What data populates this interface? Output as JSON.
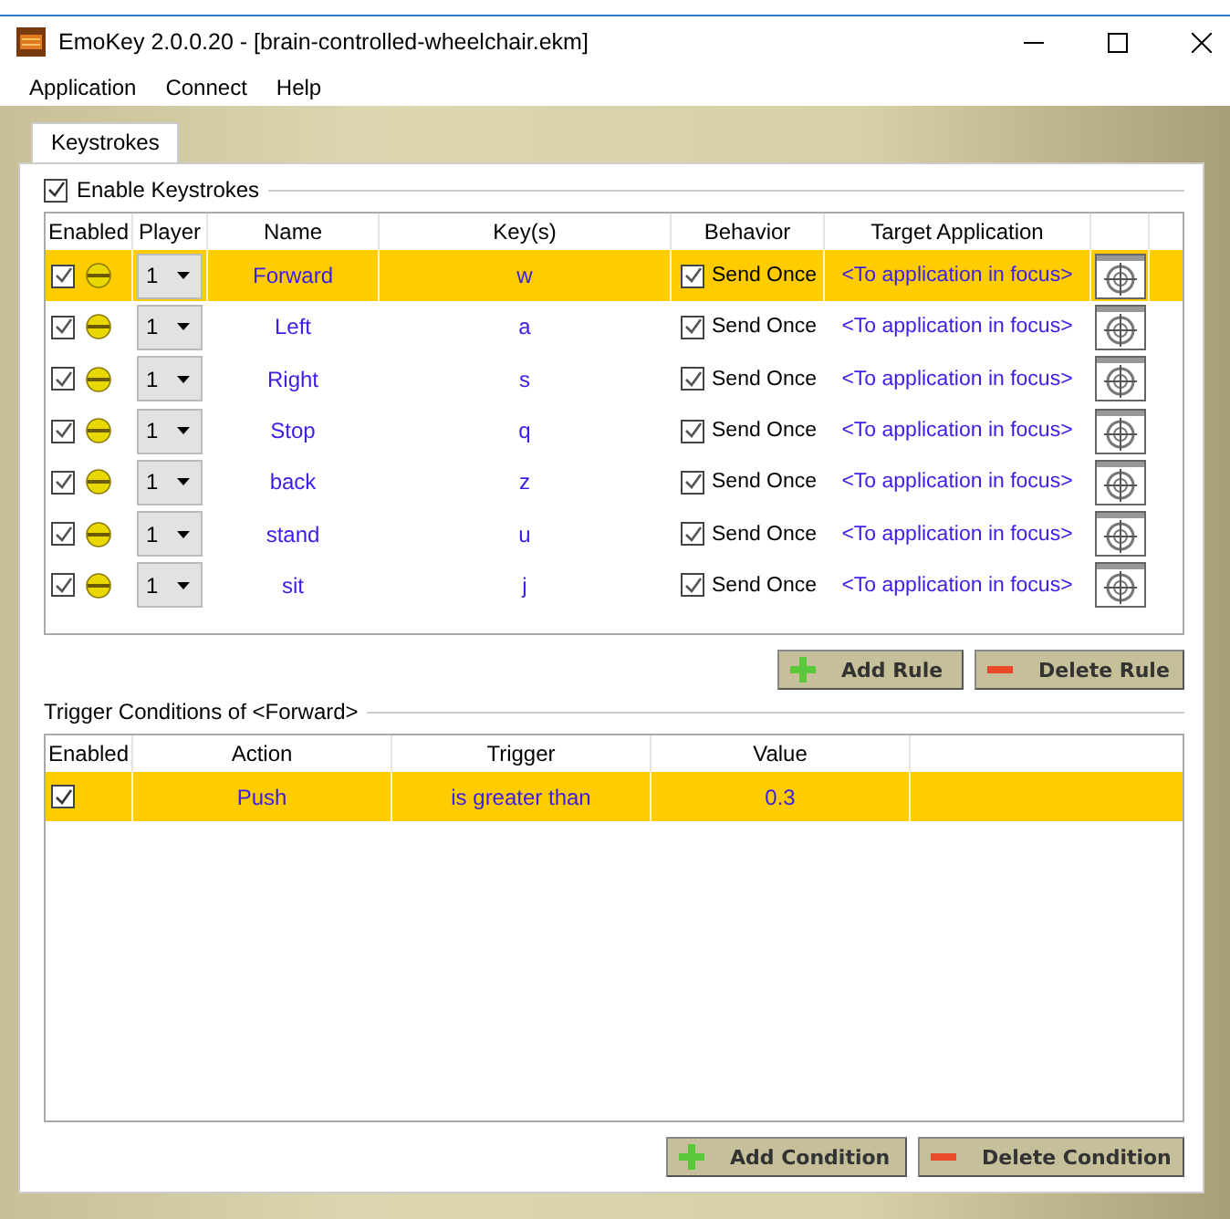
{
  "window": {
    "title": "EmoKey 2.0.0.20 - [brain-controlled-wheelchair.ekm]"
  },
  "menu": [
    "Application",
    "Connect",
    "Help"
  ],
  "tabs": [
    {
      "label": "Keystrokes",
      "selected": true
    }
  ],
  "enable_keystrokes": {
    "label": "Enable Keystrokes",
    "checked": true
  },
  "rules": {
    "columns": [
      "Enabled",
      "Player",
      "Name",
      "Key(s)",
      "Behavior",
      "Target Application"
    ],
    "rows": [
      {
        "enabled": true,
        "player": "1",
        "name": "Forward",
        "keys": "w",
        "behavior": {
          "checked": true,
          "label": "Send Once"
        },
        "target": "<To application in focus>",
        "selected": true
      },
      {
        "enabled": true,
        "player": "1",
        "name": "Left",
        "keys": "a",
        "behavior": {
          "checked": true,
          "label": "Send Once"
        },
        "target": "<To application in focus>",
        "selected": false
      },
      {
        "enabled": true,
        "player": "1",
        "name": "Right",
        "keys": "s",
        "behavior": {
          "checked": true,
          "label": "Send Once"
        },
        "target": "<To application in focus>",
        "selected": false
      },
      {
        "enabled": true,
        "player": "1",
        "name": "Stop",
        "keys": "q",
        "behavior": {
          "checked": true,
          "label": "Send Once"
        },
        "target": "<To application in focus>",
        "selected": false
      },
      {
        "enabled": true,
        "player": "1",
        "name": "back",
        "keys": "z",
        "behavior": {
          "checked": true,
          "label": "Send Once"
        },
        "target": "<To application in focus>",
        "selected": false
      },
      {
        "enabled": true,
        "player": "1",
        "name": "stand",
        "keys": "u",
        "behavior": {
          "checked": true,
          "label": "Send Once"
        },
        "target": "<To application in focus>",
        "selected": false
      },
      {
        "enabled": true,
        "player": "1",
        "name": "sit",
        "keys": "j",
        "behavior": {
          "checked": true,
          "label": "Send Once"
        },
        "target": "<To application in focus>",
        "selected": false
      }
    ]
  },
  "rule_buttons": [
    "Add Rule",
    "Delete Rule"
  ],
  "conditions": {
    "title": "Trigger Conditions of <Forward>",
    "columns": [
      "Enabled",
      "Action",
      "Trigger",
      "Value"
    ],
    "rows": [
      {
        "enabled": true,
        "action": "Push",
        "trigger": "is greater than",
        "value": "0.3",
        "selected": true
      }
    ]
  },
  "condition_buttons": [
    "Add Condition",
    "Delete Condition"
  ]
}
